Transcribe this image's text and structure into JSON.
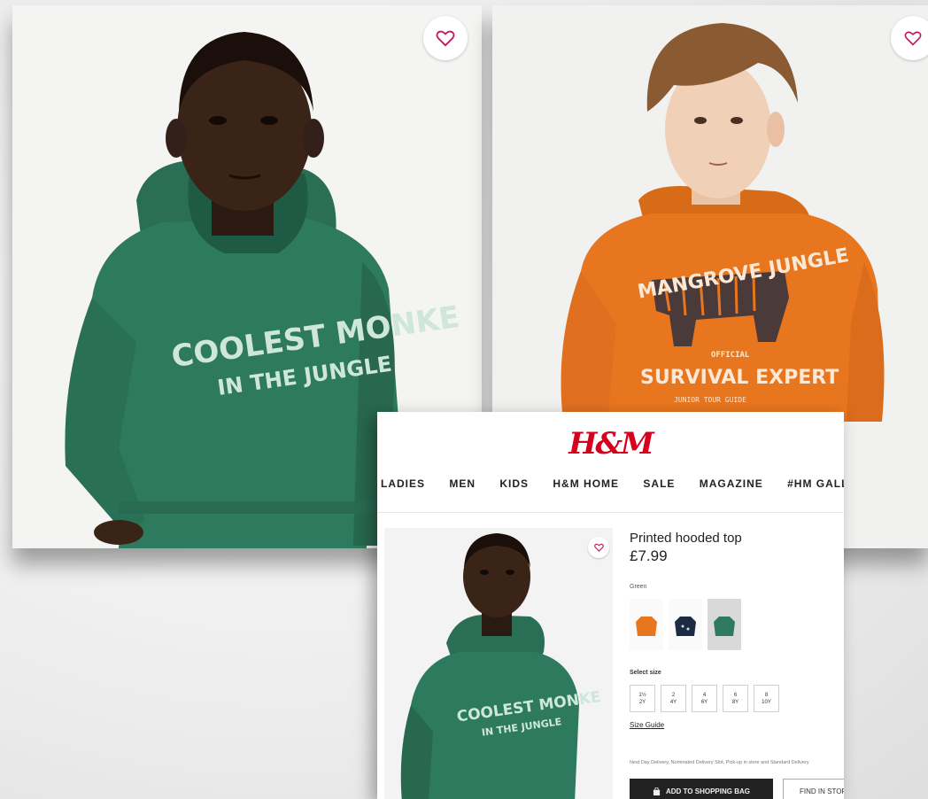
{
  "left_product": {
    "hoodie_text_line1": "COOLEST MONKE",
    "hoodie_text_line2": "IN THE JUNGLE",
    "hoodie_color": "#2e7a5e"
  },
  "right_product": {
    "hoodie_text_top": "MANGROVE JUNGLE",
    "hoodie_text_small": "OFFICIAL",
    "hoodie_text_main": "SURVIVAL EXPERT",
    "hoodie_text_bottom": "JUNIOR TOUR GUIDE",
    "hoodie_color": "#e8761f"
  },
  "product_page": {
    "logo": "H&M",
    "brand_color": "#d6001c",
    "nav": [
      "LADIES",
      "MEN",
      "KIDS",
      "H&M HOME",
      "SALE",
      "MAGAZINE",
      "#HM GALLERY"
    ],
    "title": "Printed hooded top",
    "price": "£7.99",
    "color_label": "Green",
    "size_label": "Select size",
    "sizes": [
      {
        "top": "1½",
        "bottom": "2Y"
      },
      {
        "top": "2",
        "bottom": "4Y"
      },
      {
        "top": "4",
        "bottom": "6Y"
      },
      {
        "top": "6",
        "bottom": "8Y"
      },
      {
        "top": "8",
        "bottom": "10Y"
      }
    ],
    "size_guide": "Size Guide",
    "delivery_text": "Next Day Delivery, Nominated Delivery Slot, Pick-up in store and Standard Delivery",
    "add_to_bag": "ADD TO SHOPPING BAG",
    "find_in_store": "FIND IN STORE",
    "image_text_line1": "COOLEST MONKE",
    "image_text_line2": "IN THE JUNGLE"
  }
}
